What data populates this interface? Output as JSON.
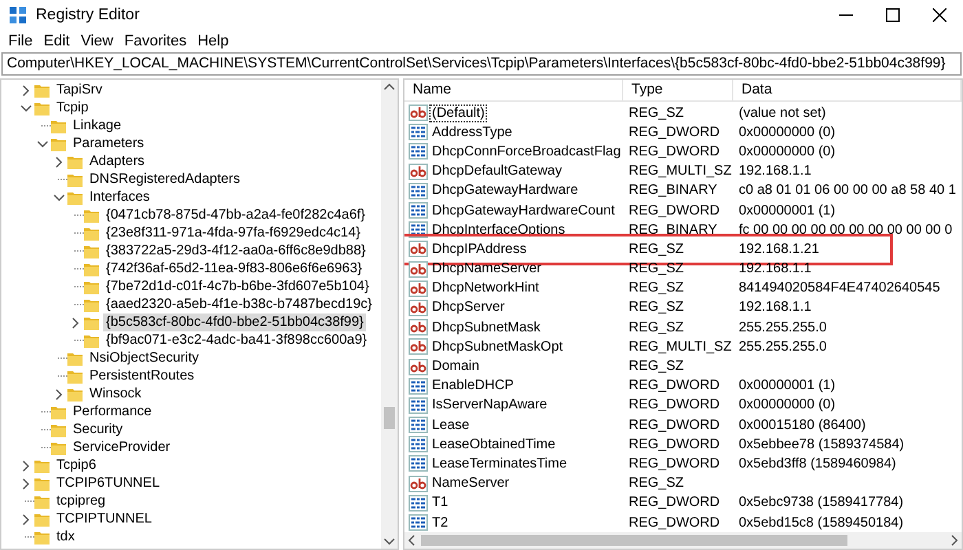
{
  "window": {
    "title": "Registry Editor"
  },
  "menu": [
    "File",
    "Edit",
    "View",
    "Favorites",
    "Help"
  ],
  "address": "Computer\\HKEY_LOCAL_MACHINE\\SYSTEM\\CurrentControlSet\\Services\\Tcpip\\Parameters\\Interfaces\\{b5c583cf-80bc-4fd0-bbe2-51bb04c38f99}",
  "tree": [
    {
      "label": "TapiSrv",
      "kind": "branch",
      "expanded": false,
      "selected": false
    },
    {
      "label": "Tcpip",
      "kind": "branch",
      "expanded": true,
      "selected": false,
      "children": [
        {
          "label": "Linkage",
          "kind": "leaf",
          "selected": false
        },
        {
          "label": "Parameters",
          "kind": "branch",
          "expanded": true,
          "selected": false,
          "children": [
            {
              "label": "Adapters",
              "kind": "branch",
              "expanded": false,
              "selected": false
            },
            {
              "label": "DNSRegisteredAdapters",
              "kind": "leaf",
              "selected": false
            },
            {
              "label": "Interfaces",
              "kind": "branch",
              "expanded": true,
              "selected": false,
              "children": [
                {
                  "label": "{0471cb78-875d-47bb-a2a4-fe0f282c4a6f}",
                  "kind": "leaf",
                  "selected": false
                },
                {
                  "label": "{23e8f311-971a-4fda-97fa-f6929edc4c14}",
                  "kind": "leaf",
                  "selected": false
                },
                {
                  "label": "{383722a5-29d3-4f12-aa0a-6ff6c8e9db88}",
                  "kind": "leaf",
                  "selected": false
                },
                {
                  "label": "{742f36af-65d2-11ea-9f83-806e6f6e6963}",
                  "kind": "leaf",
                  "selected": false
                },
                {
                  "label": "{7be72d1d-c01f-4c7b-b6be-3fd607e5b104}",
                  "kind": "leaf",
                  "selected": false
                },
                {
                  "label": "{aaed2320-a5eb-4f1e-b38c-b7487becd19c}",
                  "kind": "leaf",
                  "selected": false
                },
                {
                  "label": "{b5c583cf-80bc-4fd0-bbe2-51bb04c38f99}",
                  "kind": "branch",
                  "expanded": false,
                  "selected": true
                },
                {
                  "label": "{bf9ac071-e3c2-4adc-ba41-3f898cc600a9}",
                  "kind": "leaf",
                  "selected": false
                }
              ]
            },
            {
              "label": "NsiObjectSecurity",
              "kind": "leaf",
              "selected": false
            },
            {
              "label": "PersistentRoutes",
              "kind": "leaf",
              "selected": false
            },
            {
              "label": "Winsock",
              "kind": "branch",
              "expanded": false,
              "selected": false
            }
          ]
        },
        {
          "label": "Performance",
          "kind": "leaf",
          "selected": false
        },
        {
          "label": "Security",
          "kind": "leaf",
          "selected": false
        },
        {
          "label": "ServiceProvider",
          "kind": "leaf",
          "selected": false
        }
      ]
    },
    {
      "label": "Tcpip6",
      "kind": "branch",
      "expanded": false,
      "selected": false
    },
    {
      "label": "TCPIP6TUNNEL",
      "kind": "branch",
      "expanded": false,
      "selected": false
    },
    {
      "label": "tcpipreg",
      "kind": "leaf",
      "selected": false
    },
    {
      "label": "TCPIPTUNNEL",
      "kind": "branch",
      "expanded": false,
      "selected": false
    },
    {
      "label": "tdx",
      "kind": "leaf",
      "selected": false
    }
  ],
  "values": {
    "columns": [
      "Name",
      "Type",
      "Data"
    ],
    "rows": [
      {
        "kind": "string",
        "name": "(Default)",
        "type": "REG_SZ",
        "data": "(value not set)",
        "focused": true,
        "highlighted": false
      },
      {
        "kind": "binary",
        "name": "AddressType",
        "type": "REG_DWORD",
        "data": "0x00000000 (0)",
        "focused": false,
        "highlighted": false
      },
      {
        "kind": "binary",
        "name": "DhcpConnForceBroadcastFlag",
        "type": "REG_DWORD",
        "data": "0x00000000 (0)",
        "focused": false,
        "highlighted": false
      },
      {
        "kind": "string",
        "name": "DhcpDefaultGateway",
        "type": "REG_MULTI_SZ",
        "data": "192.168.1.1",
        "focused": false,
        "highlighted": false
      },
      {
        "kind": "binary",
        "name": "DhcpGatewayHardware",
        "type": "REG_BINARY",
        "data": "c0 a8 01 01 06 00 00 00 a8 58 40 1",
        "focused": false,
        "highlighted": false
      },
      {
        "kind": "binary",
        "name": "DhcpGatewayHardwareCount",
        "type": "REG_DWORD",
        "data": "0x00000001 (1)",
        "focused": false,
        "highlighted": false
      },
      {
        "kind": "binary",
        "name": "DhcpInterfaceOptions",
        "type": "REG_BINARY",
        "data": "fc 00 00 00 00 00 00 00 00 00 00 0",
        "focused": false,
        "highlighted": false
      },
      {
        "kind": "string",
        "name": "DhcpIPAddress",
        "type": "REG_SZ",
        "data": "192.168.1.21",
        "focused": false,
        "highlighted": true
      },
      {
        "kind": "string",
        "name": "DhcpNameServer",
        "type": "REG_SZ",
        "data": "192.168.1.1",
        "focused": false,
        "highlighted": false
      },
      {
        "kind": "string",
        "name": "DhcpNetworkHint",
        "type": "REG_SZ",
        "data": "841494020584F4E47402640545",
        "focused": false,
        "highlighted": false
      },
      {
        "kind": "string",
        "name": "DhcpServer",
        "type": "REG_SZ",
        "data": "192.168.1.1",
        "focused": false,
        "highlighted": false
      },
      {
        "kind": "string",
        "name": "DhcpSubnetMask",
        "type": "REG_SZ",
        "data": "255.255.255.0",
        "focused": false,
        "highlighted": false
      },
      {
        "kind": "string",
        "name": "DhcpSubnetMaskOpt",
        "type": "REG_MULTI_SZ",
        "data": "255.255.255.0",
        "focused": false,
        "highlighted": false
      },
      {
        "kind": "string",
        "name": "Domain",
        "type": "REG_SZ",
        "focused": false,
        "highlighted": false
      },
      {
        "kind": "binary",
        "name": "EnableDHCP",
        "type": "REG_DWORD",
        "data": "0x00000001 (1)",
        "focused": false,
        "highlighted": false
      },
      {
        "kind": "binary",
        "name": "IsServerNapAware",
        "type": "REG_DWORD",
        "data": "0x00000000 (0)",
        "focused": false,
        "highlighted": false
      },
      {
        "kind": "binary",
        "name": "Lease",
        "type": "REG_DWORD",
        "data": "0x00015180 (86400)",
        "focused": false,
        "highlighted": false
      },
      {
        "kind": "binary",
        "name": "LeaseObtainedTime",
        "type": "REG_DWORD",
        "data": "0x5ebbee78 (1589374584)",
        "focused": false,
        "highlighted": false
      },
      {
        "kind": "binary",
        "name": "LeaseTerminatesTime",
        "type": "REG_DWORD",
        "data": "0x5ebd3ff8 (1589460984)",
        "focused": false,
        "highlighted": false
      },
      {
        "kind": "string",
        "name": "NameServer",
        "type": "REG_SZ",
        "focused": false,
        "highlighted": false
      },
      {
        "kind": "binary",
        "name": "T1",
        "type": "REG_DWORD",
        "data": "0x5ebc9738 (1589417784)",
        "focused": false,
        "highlighted": false
      },
      {
        "kind": "binary",
        "name": "T2",
        "type": "REG_DWORD",
        "data": "0x5ebd15c8 (1589450184)",
        "focused": false,
        "highlighted": false
      }
    ]
  }
}
